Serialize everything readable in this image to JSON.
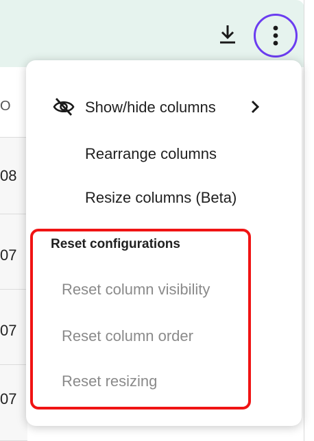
{
  "table": {
    "header_partial": "O",
    "row_values": [
      "08",
      "07",
      "07",
      "07"
    ]
  },
  "menu": {
    "items": [
      {
        "label": "Show/hide columns",
        "icon": "eye-slash-icon",
        "submenu": true
      },
      {
        "label": "Rearrange columns"
      },
      {
        "label": "Resize columns (Beta)"
      }
    ],
    "reset_section": {
      "title": "Reset configurations",
      "items": [
        {
          "label": "Reset column visibility"
        },
        {
          "label": "Reset column order"
        },
        {
          "label": "Reset resizing"
        }
      ]
    }
  },
  "colors": {
    "topbar_bg": "#e6f3ee",
    "more_button_ring": "#6b3cf0",
    "highlight_border": "#f01414",
    "muted_text": "#8a8a8a"
  }
}
